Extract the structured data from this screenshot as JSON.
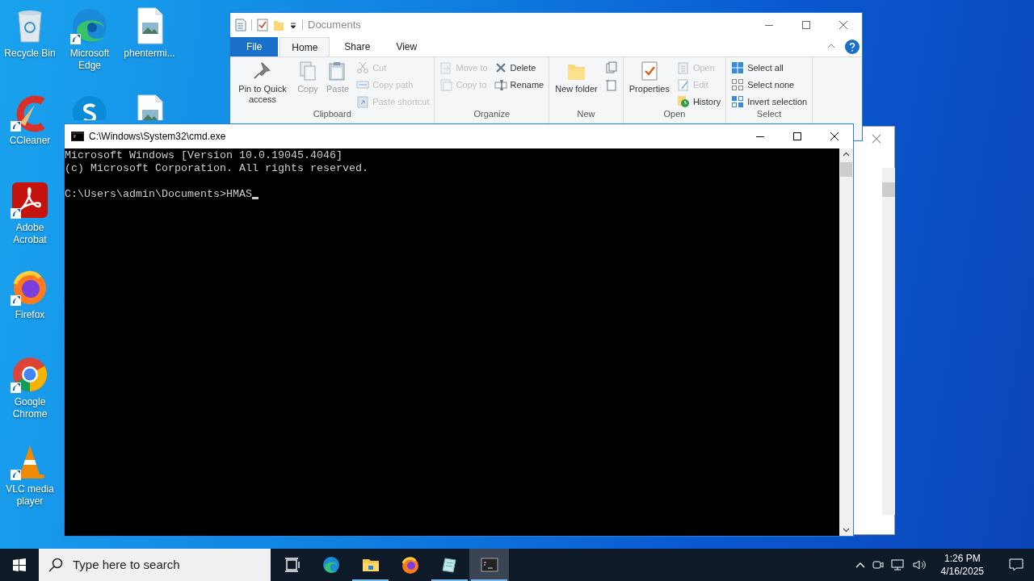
{
  "desktop_columns": [
    [
      {
        "kind": "recycle",
        "label": "Recycle Bin",
        "shortcut": false
      },
      {
        "kind": "ccleaner",
        "label": "CCleaner",
        "shortcut": true
      },
      {
        "kind": "acrobat",
        "label": "Adobe Acrobat",
        "shortcut": true
      },
      {
        "kind": "firefox",
        "label": "Firefox",
        "shortcut": true
      },
      {
        "kind": "chrome",
        "label": "Google Chrome",
        "shortcut": true
      },
      {
        "kind": "vlc",
        "label": "VLC media player",
        "shortcut": true
      }
    ],
    [
      {
        "kind": "edge",
        "label": "Microsoft Edge",
        "shortcut": true
      },
      {
        "kind": "skype"
      }
    ],
    [
      {
        "kind": "image-file",
        "label": "phentermi...",
        "shortcut": false
      },
      {
        "kind": "image-file"
      }
    ]
  ],
  "explorer": {
    "title": "Documents",
    "tabs": [
      {
        "label": "File",
        "kind": "file",
        "selected": false
      },
      {
        "label": "Home",
        "kind": "tab",
        "selected": true
      },
      {
        "label": "Share",
        "kind": "tab",
        "selected": false
      },
      {
        "label": "View",
        "kind": "tab",
        "selected": false
      }
    ],
    "groups": [
      {
        "label": "Clipboard",
        "items": [
          {
            "kind": "large",
            "label": "Pin to Quick access",
            "disabled": false
          },
          {
            "kind": "large",
            "label": "Copy",
            "disabled": true
          },
          {
            "kind": "large",
            "label": "Paste",
            "disabled": true
          },
          {
            "kind": "stack",
            "items": [
              {
                "label": "Cut",
                "disabled": true
              },
              {
                "label": "Copy path",
                "disabled": true
              },
              {
                "label": "Paste shortcut",
                "disabled": true
              }
            ]
          }
        ]
      },
      {
        "label": "Organize",
        "items": [
          {
            "kind": "stack",
            "items": [
              {
                "label": "Move to",
                "disabled": true
              },
              {
                "label": "Copy to",
                "disabled": true
              }
            ]
          },
          {
            "kind": "stack",
            "items": [
              {
                "label": "Delete",
                "disabled": false
              },
              {
                "label": "Rename",
                "disabled": false
              }
            ]
          }
        ]
      },
      {
        "label": "New",
        "items": [
          {
            "kind": "large",
            "label": "New folder",
            "disabled": false
          },
          {
            "kind": "stack",
            "items": [
              {
                "disabled": false
              },
              {
                "disabled": false
              }
            ]
          }
        ]
      },
      {
        "label": "Open",
        "items": [
          {
            "kind": "large",
            "label": "Properties",
            "disabled": false
          },
          {
            "kind": "stack",
            "items": [
              {
                "label": "Open",
                "disabled": true
              },
              {
                "label": "Edit",
                "disabled": true
              },
              {
                "label": "History",
                "disabled": false
              }
            ]
          }
        ]
      },
      {
        "label": "Select",
        "items": [
          {
            "kind": "stack",
            "items": [
              {
                "label": "Select all",
                "disabled": false
              },
              {
                "label": "Select none",
                "disabled": false
              },
              {
                "label": "Invert selection",
                "disabled": false
              }
            ]
          }
        ]
      }
    ]
  },
  "cmd": {
    "title": "C:\\Windows\\System32\\cmd.exe",
    "lines": [
      "Microsoft Windows [Version 10.0.19045.4046]",
      "(c) Microsoft Corporation. All rights reserved."
    ],
    "prompt": "C:\\Users\\admin\\Documents>",
    "input": "HMAS"
  },
  "taskbar": {
    "search_placeholder": "Type here to search",
    "apps": [
      {
        "kind": "taskview",
        "running": false,
        "selected": false
      },
      {
        "kind": "edge",
        "running": false,
        "selected": false
      },
      {
        "kind": "explorer",
        "running": true,
        "selected": false
      },
      {
        "kind": "firefox",
        "running": false,
        "selected": false
      },
      {
        "kind": "notepad",
        "running": true,
        "selected": false
      },
      {
        "kind": "cmd",
        "running": true,
        "selected": true
      }
    ],
    "time": "1:26 PM",
    "date": "4/16/2025"
  }
}
